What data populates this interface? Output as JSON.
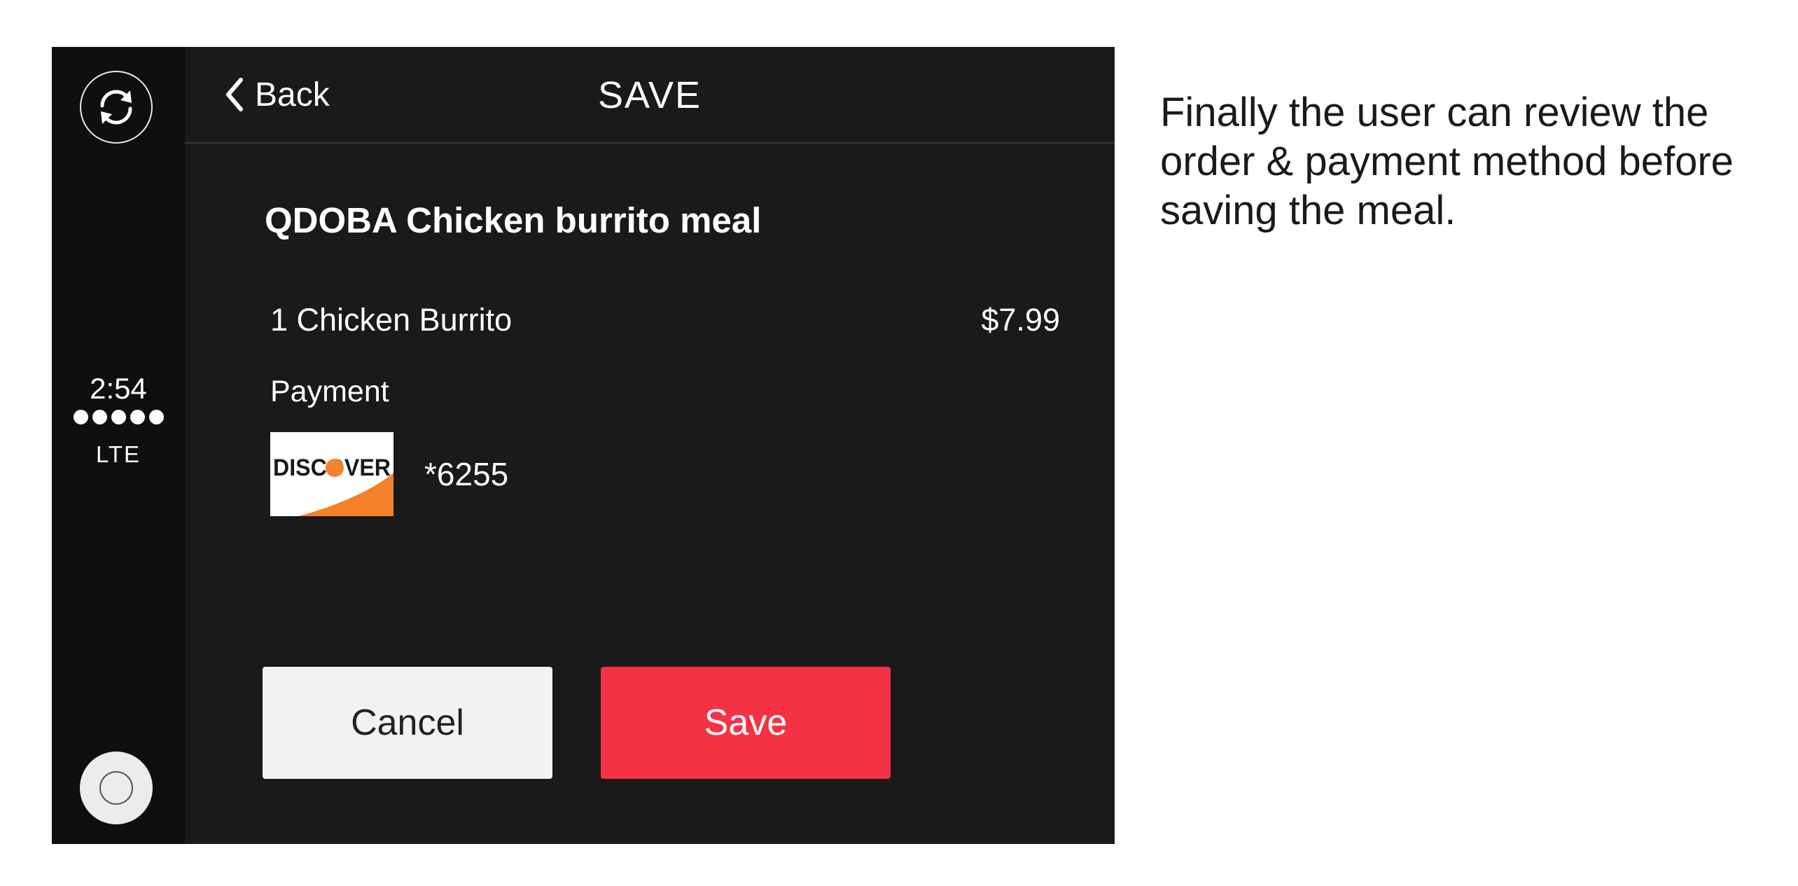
{
  "sidebar": {
    "sync_icon": "sync-arrows-icon",
    "time": "2:54",
    "signal_dots": 5,
    "network": "LTE",
    "home_icon": "home-button-icon"
  },
  "header": {
    "back_label": "Back",
    "back_icon": "chevron-left-icon",
    "title": "SAVE"
  },
  "order": {
    "meal_title": "QDOBA Chicken burrito meal",
    "items": [
      {
        "name": "1 Chicken Burrito",
        "price": "$7.99"
      }
    ],
    "payment_label": "Payment",
    "card": {
      "brand": "DISCOVER",
      "last4": "*6255"
    }
  },
  "actions": {
    "cancel_label": "Cancel",
    "save_label": "Save"
  },
  "colors": {
    "accent": "#f53243",
    "background": "#1a1a1a",
    "discover_orange": "#f5822a"
  },
  "caption": "Finally the user can review the order & payment method before saving the meal."
}
